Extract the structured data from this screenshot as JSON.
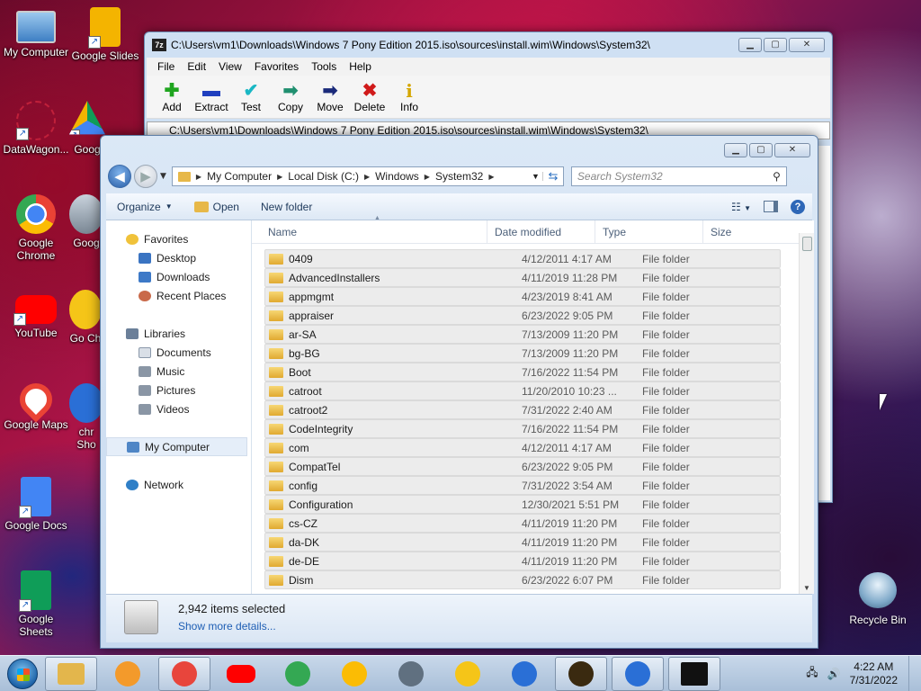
{
  "desktop": {
    "icons": [
      {
        "label": "My Computer"
      },
      {
        "label": "Google Slides"
      },
      {
        "label": "DataWagon..."
      },
      {
        "label": "Goog"
      },
      {
        "label": "Google Chrome"
      },
      {
        "label": "Goog"
      },
      {
        "label": "YouTube"
      },
      {
        "label": "Go Ch"
      },
      {
        "label": "Google Maps"
      },
      {
        "label": "chr Sho"
      },
      {
        "label": "Google Docs"
      },
      {
        "label": "Google Sheets"
      }
    ],
    "recycle_bin": "Recycle Bin"
  },
  "zip_window": {
    "title": "C:\\Users\\vm1\\Downloads\\Windows 7 Pony Edition 2015.iso\\sources\\install.wim\\Windows\\System32\\",
    "logo": "7z",
    "menu": [
      "File",
      "Edit",
      "View",
      "Favorites",
      "Tools",
      "Help"
    ],
    "toolbar": [
      {
        "label": "Add",
        "icon": "plus-icon",
        "glyph": "✚",
        "color": "#1fa51f"
      },
      {
        "label": "Extract",
        "icon": "minus-icon",
        "glyph": "▬",
        "color": "#1f3fbf"
      },
      {
        "label": "Test",
        "icon": "check-icon",
        "glyph": "✔",
        "color": "#19b7c4"
      },
      {
        "label": "Copy",
        "icon": "copy-arrow-icon",
        "glyph": "➡",
        "color": "#1f8f6f"
      },
      {
        "label": "Move",
        "icon": "move-arrow-icon",
        "glyph": "➡",
        "color": "#1a2a7a"
      },
      {
        "label": "Delete",
        "icon": "delete-x-icon",
        "glyph": "✖",
        "color": "#d01a1a"
      },
      {
        "label": "Info",
        "icon": "info-icon",
        "glyph": "i",
        "color": "#d4a600"
      }
    ],
    "address": "C:\\Users\\vm1\\Downloads\\Windows 7 Pony Edition 2015.iso\\sources\\install.wim\\Windows\\System32\\"
  },
  "explorer": {
    "breadcrumb": [
      "My Computer",
      "Local Disk (C:)",
      "Windows",
      "System32"
    ],
    "search_placeholder": "Search System32",
    "commands": {
      "organize": "Organize",
      "open": "Open",
      "new_folder": "New folder"
    },
    "nav": {
      "favorites": "Favorites",
      "desktop": "Desktop",
      "downloads": "Downloads",
      "recent": "Recent Places",
      "libraries": "Libraries",
      "documents": "Documents",
      "music": "Music",
      "pictures": "Pictures",
      "videos": "Videos",
      "computer": "My Computer",
      "network": "Network"
    },
    "columns": {
      "name": "Name",
      "date": "Date modified",
      "type": "Type",
      "size": "Size"
    },
    "rows": [
      {
        "name": "0409",
        "date": "4/12/2011 4:17 AM",
        "type": "File folder"
      },
      {
        "name": "AdvancedInstallers",
        "date": "4/11/2019 11:28 PM",
        "type": "File folder"
      },
      {
        "name": "appmgmt",
        "date": "4/23/2019 8:41 AM",
        "type": "File folder"
      },
      {
        "name": "appraiser",
        "date": "6/23/2022 9:05 PM",
        "type": "File folder"
      },
      {
        "name": "ar-SA",
        "date": "7/13/2009 11:20 PM",
        "type": "File folder"
      },
      {
        "name": "bg-BG",
        "date": "7/13/2009 11:20 PM",
        "type": "File folder"
      },
      {
        "name": "Boot",
        "date": "7/16/2022 11:54 PM",
        "type": "File folder"
      },
      {
        "name": "catroot",
        "date": "11/20/2010 10:23 ...",
        "type": "File folder"
      },
      {
        "name": "catroot2",
        "date": "7/31/2022 2:40 AM",
        "type": "File folder"
      },
      {
        "name": "CodeIntegrity",
        "date": "7/16/2022 11:54 PM",
        "type": "File folder"
      },
      {
        "name": "com",
        "date": "4/12/2011 4:17 AM",
        "type": "File folder"
      },
      {
        "name": "CompatTel",
        "date": "6/23/2022 9:05 PM",
        "type": "File folder"
      },
      {
        "name": "config",
        "date": "7/31/2022 3:54 AM",
        "type": "File folder"
      },
      {
        "name": "Configuration",
        "date": "12/30/2021 5:51 PM",
        "type": "File folder"
      },
      {
        "name": "cs-CZ",
        "date": "4/11/2019 11:20 PM",
        "type": "File folder"
      },
      {
        "name": "da-DK",
        "date": "4/11/2019 11:20 PM",
        "type": "File folder"
      },
      {
        "name": "de-DE",
        "date": "4/11/2019 11:20 PM",
        "type": "File folder"
      },
      {
        "name": "Dism",
        "date": "6/23/2022 6:07 PM",
        "type": "File folder"
      }
    ],
    "details": {
      "count": "2,942 items selected",
      "more": "Show more details..."
    }
  },
  "taskbar": {
    "time": "4:22 AM",
    "date": "7/31/2022",
    "apps": [
      {
        "name": "explorer-taskbar",
        "color": "#e3b64c",
        "boxed": true
      },
      {
        "name": "media-player-taskbar",
        "color": "#f39a2b",
        "boxed": false
      },
      {
        "name": "chrome-taskbar",
        "color": "#e8453c",
        "boxed": true
      },
      {
        "name": "youtube-taskbar",
        "color": "#ff0000",
        "boxed": false
      },
      {
        "name": "maps-taskbar",
        "color": "#34a853",
        "boxed": false
      },
      {
        "name": "drive-taskbar",
        "color": "#fbbc04",
        "boxed": false
      },
      {
        "name": "earth-pro-taskbar",
        "color": "#607080",
        "boxed": false
      },
      {
        "name": "chrome-canary-taskbar",
        "color": "#f5c518",
        "boxed": false
      },
      {
        "name": "chrome-blue-taskbar",
        "color": "#2a6fd6",
        "boxed": false
      },
      {
        "name": "bluestacks-taskbar",
        "color": "#3a2a10",
        "boxed": true
      },
      {
        "name": "chrome-blue-2-taskbar",
        "color": "#2a6fd6",
        "boxed": true
      },
      {
        "name": "sevenzip-taskbar",
        "color": "#111111",
        "boxed": true
      }
    ]
  }
}
